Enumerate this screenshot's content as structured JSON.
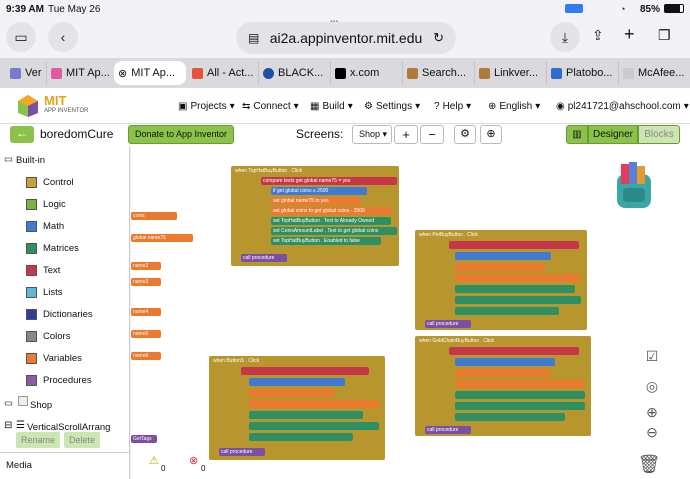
{
  "status": {
    "time": "9:39 AM",
    "date": "Tue May 26",
    "battery": "85%"
  },
  "browser": {
    "url": "ai2a.appinventor.mit.edu",
    "dots": "•••",
    "tabs": [
      {
        "label": "Ver",
        "color": "#7a7ad0"
      },
      {
        "label": "MIT Ap...",
        "color": "#e05aa0"
      },
      {
        "label": "MIT Ap...",
        "color": "#e05aa0"
      },
      {
        "label": "All - Act...",
        "color": "#e5523e"
      },
      {
        "label": "BLACK...",
        "color": "#1b4fa8"
      },
      {
        "label": "x.com",
        "color": "#000000"
      },
      {
        "label": "Search...",
        "color": "#b2793e"
      },
      {
        "label": "Linkver...",
        "color": "#b2793e"
      },
      {
        "label": "Platobo...",
        "color": "#2f6ccf"
      },
      {
        "label": "McAfee...",
        "color": "#cccccc"
      }
    ]
  },
  "app": {
    "logo": "MIT",
    "logo_sub": "APP INVENTOR",
    "menus": [
      "Projects",
      "Connect",
      "Build",
      "Settings",
      "Help",
      "English"
    ],
    "user": "pl241721@ahschool.com"
  },
  "toolbar": {
    "project": "boredomCure",
    "donate": "Donate to App Inventor",
    "screens_label": "Screens:",
    "screen": "Shop",
    "add": "+",
    "remove": "−",
    "designer": "Designer",
    "blocks": "Blocks"
  },
  "panel": {
    "builtin": "Built-in",
    "items": [
      {
        "label": "Control",
        "color": "#c9a036"
      },
      {
        "label": "Logic",
        "color": "#7cb342"
      },
      {
        "label": "Math",
        "color": "#3f7bd1"
      },
      {
        "label": "Matrices",
        "color": "#2e8f62"
      },
      {
        "label": "Text",
        "color": "#c7374a"
      },
      {
        "label": "Lists",
        "color": "#5bb8d6"
      },
      {
        "label": "Dictionaries",
        "color": "#2d3e9e"
      },
      {
        "label": "Colors",
        "color": "#888888"
      },
      {
        "label": "Variables",
        "color": "#e97a30"
      },
      {
        "label": "Procedures",
        "color": "#8e5aa6"
      }
    ],
    "shop": "Shop",
    "vsa": "VerticalScrollArrang",
    "rename": "Rename",
    "delete": "Delete",
    "media": "Media"
  },
  "workspace": {
    "events": [
      {
        "label": "when TopHatBuyButton . Click",
        "call": "call procedure"
      },
      {
        "label": "when PetBuyButton . Click",
        "call": "call procedure"
      },
      {
        "label": "when GoldChainBuyButton . Click",
        "call": "call procedure"
      },
      {
        "label": "when ButtonS . Click",
        "call": "call procedure"
      }
    ],
    "rows": [
      "compare texts get global name75 = yes",
      "if get global coins ≥ 2500",
      "set global name75 to yes",
      "set global coins to get global coins - 2500",
      "set TopHatBuyButton . Text to Already Owned",
      "set CoinsAmountLabel . Text to get global coins",
      "set TopHatBuyButton . Enabled to false"
    ],
    "edge_labels": [
      "coins",
      "global name75",
      "name2",
      "name3",
      "name4",
      "name5",
      "name6",
      "GetTags"
    ],
    "warnings": "0",
    "errors": "0"
  },
  "colors": {
    "accent": "#8bc34a",
    "control": "#b8962e",
    "math": "#3f7bd1",
    "text": "#c7374a",
    "variables": "#e97a30",
    "component": "#2e8f62"
  }
}
